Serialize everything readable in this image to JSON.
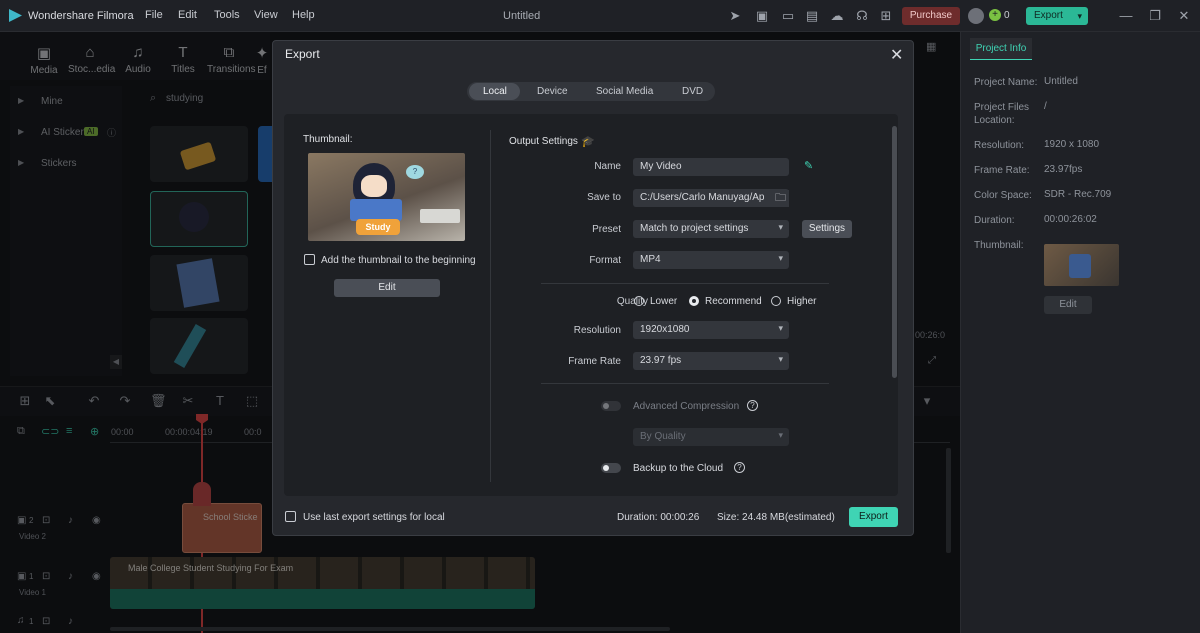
{
  "app": {
    "name": "Wondershare Filmora",
    "document_title": "Untitled"
  },
  "menu": [
    "File",
    "Edit",
    "Tools",
    "View",
    "Help"
  ],
  "titlebar": {
    "purchase_label": "Purchase",
    "credits": "0",
    "export_label": "Export"
  },
  "tools": [
    "Media",
    "Stoc...edia",
    "Audio",
    "Titles",
    "Transitions",
    "Ef"
  ],
  "sidebar": {
    "items": [
      "Mine",
      "AI Sticker",
      "Stickers"
    ],
    "ai_badge": "AI"
  },
  "asset_search": {
    "value": "studying"
  },
  "timeline": {
    "ruler_ticks": [
      "00:00",
      "00:00:04:19",
      "00:0"
    ],
    "tracks": [
      {
        "label": "Video 2",
        "index": "2",
        "clip": "School Sticke"
      },
      {
        "label": "Video 1",
        "index": "1",
        "clip": "Male College Student Studying For Exam"
      },
      {
        "label": "",
        "index": "1",
        "clip": ""
      }
    ],
    "preview_time": "00:26:0"
  },
  "project_info": {
    "tab": "Project Info",
    "rows": [
      {
        "label": "Project Name:",
        "value": "Untitled"
      },
      {
        "label": "Project Files Location:",
        "value": "/"
      },
      {
        "label": "Resolution:",
        "value": "1920 x 1080"
      },
      {
        "label": "Frame Rate:",
        "value": "23.97fps"
      },
      {
        "label": "Color Space:",
        "value": "SDR - Rec.709"
      },
      {
        "label": "Duration:",
        "value": "00:00:26:02"
      },
      {
        "label": "Thumbnail:",
        "value": ""
      }
    ],
    "edit_label": "Edit"
  },
  "dialog": {
    "title": "Export",
    "tabs": [
      "Local",
      "Device",
      "Social Media",
      "DVD"
    ],
    "active_tab": "Local",
    "thumbnail": {
      "heading": "Thumbnail:",
      "add_checkbox_label": "Add the thumbnail to the beginning",
      "edit_label": "Edit",
      "sticker_text": "Study"
    },
    "output": {
      "heading": "Output Settings",
      "name_label": "Name",
      "name_value": "My Video",
      "save_label": "Save to",
      "save_value": "C:/Users/Carlo Manuyag/Ap",
      "preset_label": "Preset",
      "preset_value": "Match to project settings",
      "settings_label": "Settings",
      "format_label": "Format",
      "format_value": "MP4",
      "quality_label": "Quality",
      "quality_options": [
        "Lower",
        "Recommend",
        "Higher"
      ],
      "quality_selected": "Recommend",
      "resolution_label": "Resolution",
      "resolution_value": "1920x1080",
      "framerate_label": "Frame Rate",
      "framerate_value": "23.97 fps",
      "adv_compression_label": "Advanced Compression",
      "by_quality_value": "By Quality",
      "backup_label": "Backup to the Cloud"
    },
    "footer": {
      "use_last_label": "Use last export settings for local",
      "duration": "Duration: 00:00:26",
      "size": "Size: 24.48 MB(estimated)",
      "export_label": "Export"
    }
  },
  "colors": {
    "accent": "#3fd4b4",
    "purchase": "#6e2c2c",
    "dialog_bg": "#26282d"
  }
}
